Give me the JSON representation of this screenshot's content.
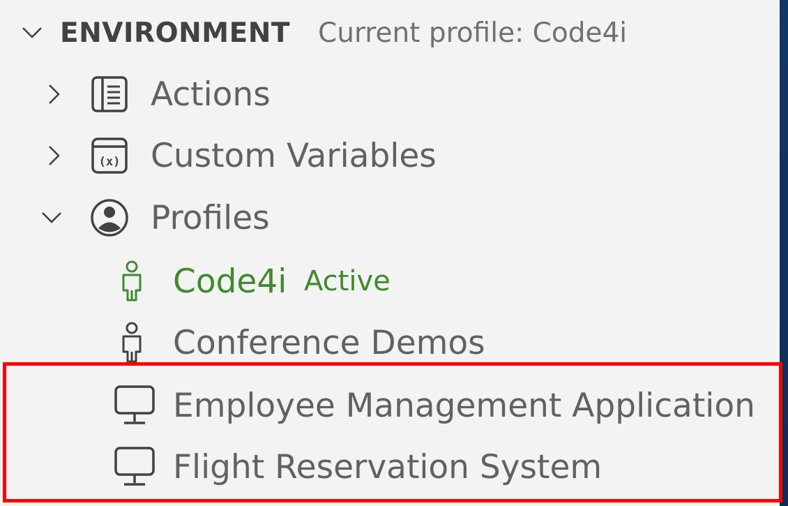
{
  "section": {
    "title": "ENVIRONMENT",
    "description": "Current profile: Code4i"
  },
  "tree": {
    "actions": {
      "label": "Actions",
      "icon": "book-icon"
    },
    "custom_variables": {
      "label": "Custom Variables",
      "icon": "variable-icon"
    },
    "profiles": {
      "label": "Profiles",
      "icon": "account-icon"
    },
    "profile_code4i": {
      "label": "Code4i",
      "description": "Active",
      "icon": "person-icon"
    },
    "profile_conference": {
      "label": "Conference Demos",
      "icon": "person-icon"
    },
    "profile_employee": {
      "label": "Employee Management Application",
      "icon": "monitor-icon"
    },
    "profile_flight": {
      "label": "Flight Reservation System",
      "icon": "monitor-icon"
    }
  },
  "colors": {
    "background": "#f3f3f3",
    "text": "#616161",
    "active": "#3f8a2e",
    "highlight_border": "#ff0000"
  }
}
